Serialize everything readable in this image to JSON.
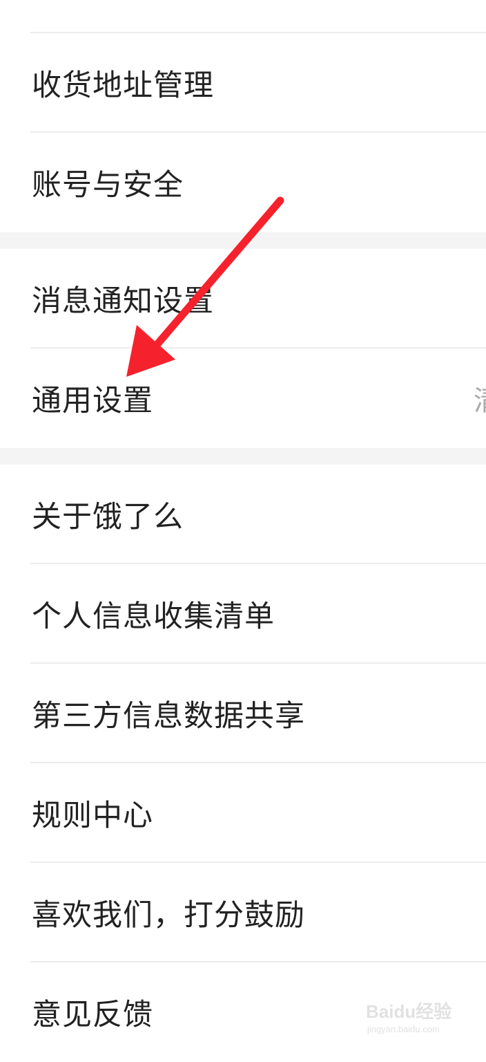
{
  "groups": [
    {
      "items": [
        {
          "label": "收货地址管理"
        },
        {
          "label": "账号与安全"
        }
      ]
    },
    {
      "items": [
        {
          "label": "消息通知设置"
        },
        {
          "label": "通用设置",
          "trailing": "清"
        }
      ]
    },
    {
      "items": [
        {
          "label": "关于饿了么"
        },
        {
          "label": "个人信息收集清单"
        },
        {
          "label": "第三方信息数据共享"
        },
        {
          "label": "规则中心"
        },
        {
          "label": "喜欢我们，打分鼓励"
        },
        {
          "label": "意见反馈"
        }
      ]
    }
  ],
  "annotation": {
    "color": "#f5222d"
  },
  "watermark": {
    "text": "Baidu经验",
    "subtext": "jingyan.baidu.com"
  }
}
